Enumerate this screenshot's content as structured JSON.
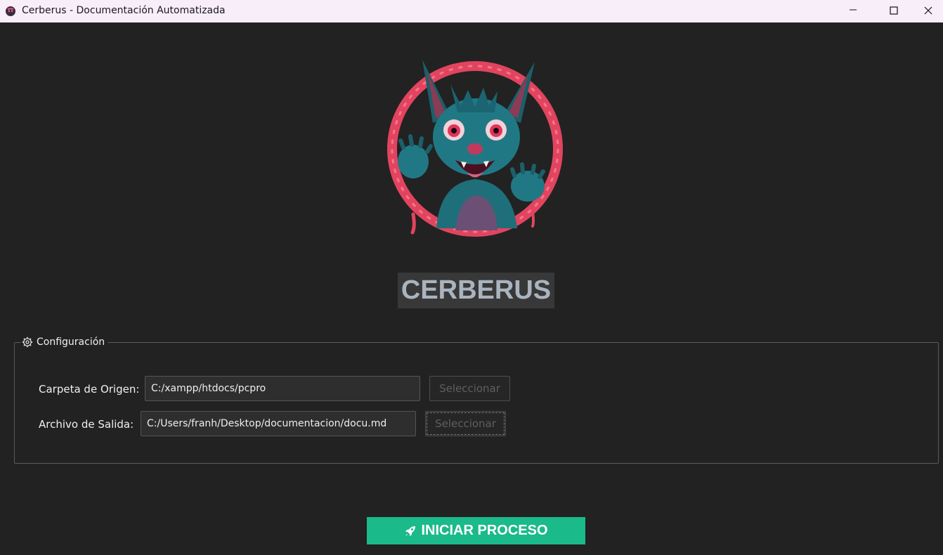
{
  "window": {
    "title": "Cerberus - Documentación Automatizada",
    "icon": "cerberus-app-icon",
    "controls": [
      "minimize-icon",
      "maximize-icon",
      "close-icon"
    ]
  },
  "logo": {
    "icon": "cerberus-creature-logo"
  },
  "heading": "CERBERUS",
  "config": {
    "legend_icon": "gear-icon",
    "legend": "Configuración",
    "source": {
      "label": "Carpeta de Origen:",
      "value": "C:/xampp/htdocs/pcpro",
      "button": "Seleccionar"
    },
    "output": {
      "label": "Archivo de Salida:",
      "value": "C:/Users/franh/Desktop/documentacion/docu.md",
      "button": "Seleccionar"
    }
  },
  "start_button": {
    "icon": "rocket-icon",
    "label": "INICIAR PROCESO"
  },
  "colors": {
    "background": "#222222",
    "titlebar": "#f7eefa",
    "accent": "#1aba8a",
    "heading_bg": "#383838",
    "heading_text": "#a9b4bf"
  }
}
